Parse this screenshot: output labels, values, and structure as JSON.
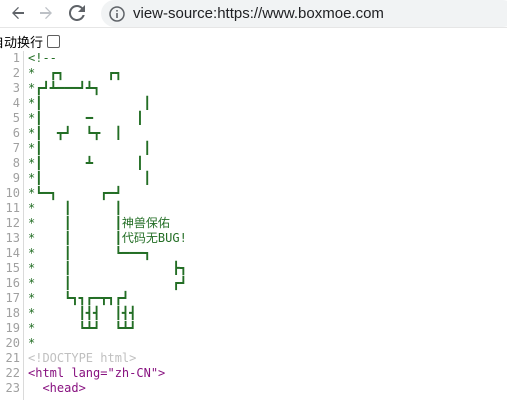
{
  "browser": {
    "url": "view-source:https://www.boxmoe.com"
  },
  "wrap_bar": {
    "label": "自动换行"
  },
  "source_lines": [
    "<!--",
    "*  ┏┓      ┏┓",
    "*┏┛┻━━━┛┻┓",
    "*┃              ┃",
    "*┃      ━      ┃",
    "*┃  ┳┛  ┗┳  ┃",
    "*┃              ┃",
    "*┃      ┻      ┃",
    "*┃              ┃",
    "*┗━┓      ┏━┛",
    "*    ┃      ┃",
    "*    ┃      ┃神兽保佑",
    "*    ┃      ┃代码无BUG!",
    "*    ┃      ┗━━━┓",
    "*    ┃              ┣┓",
    "*    ┃              ┏┛",
    "*    ┗┓┓┏━┳┓┏┛",
    "*      ┃┫┫  ┃┫┫",
    "*      ┗┻┛  ┗┻┛",
    "*",
    "-->",
    "<!DOCTYPE html>",
    "<html lang=\"zh-CN\">",
    "  <head>"
  ],
  "line_numbers": [
    "1",
    "2",
    "3",
    "4",
    "5",
    "6",
    "7",
    "8",
    "9",
    "10",
    "11",
    "12",
    "13",
    "14",
    "15",
    "16",
    "17",
    "18",
    "19",
    "20",
    "21",
    "22",
    "23"
  ],
  "colors": {
    "comment": "#236e25",
    "doctype": "#c0c0c0",
    "tag": "#881280",
    "attr_name": "#994500",
    "attr_value": "#1a1aa6",
    "line_number": "#a0a0a0"
  },
  "icons": [
    "back-arrow-icon",
    "forward-arrow-icon",
    "reload-icon",
    "info-icon"
  ]
}
